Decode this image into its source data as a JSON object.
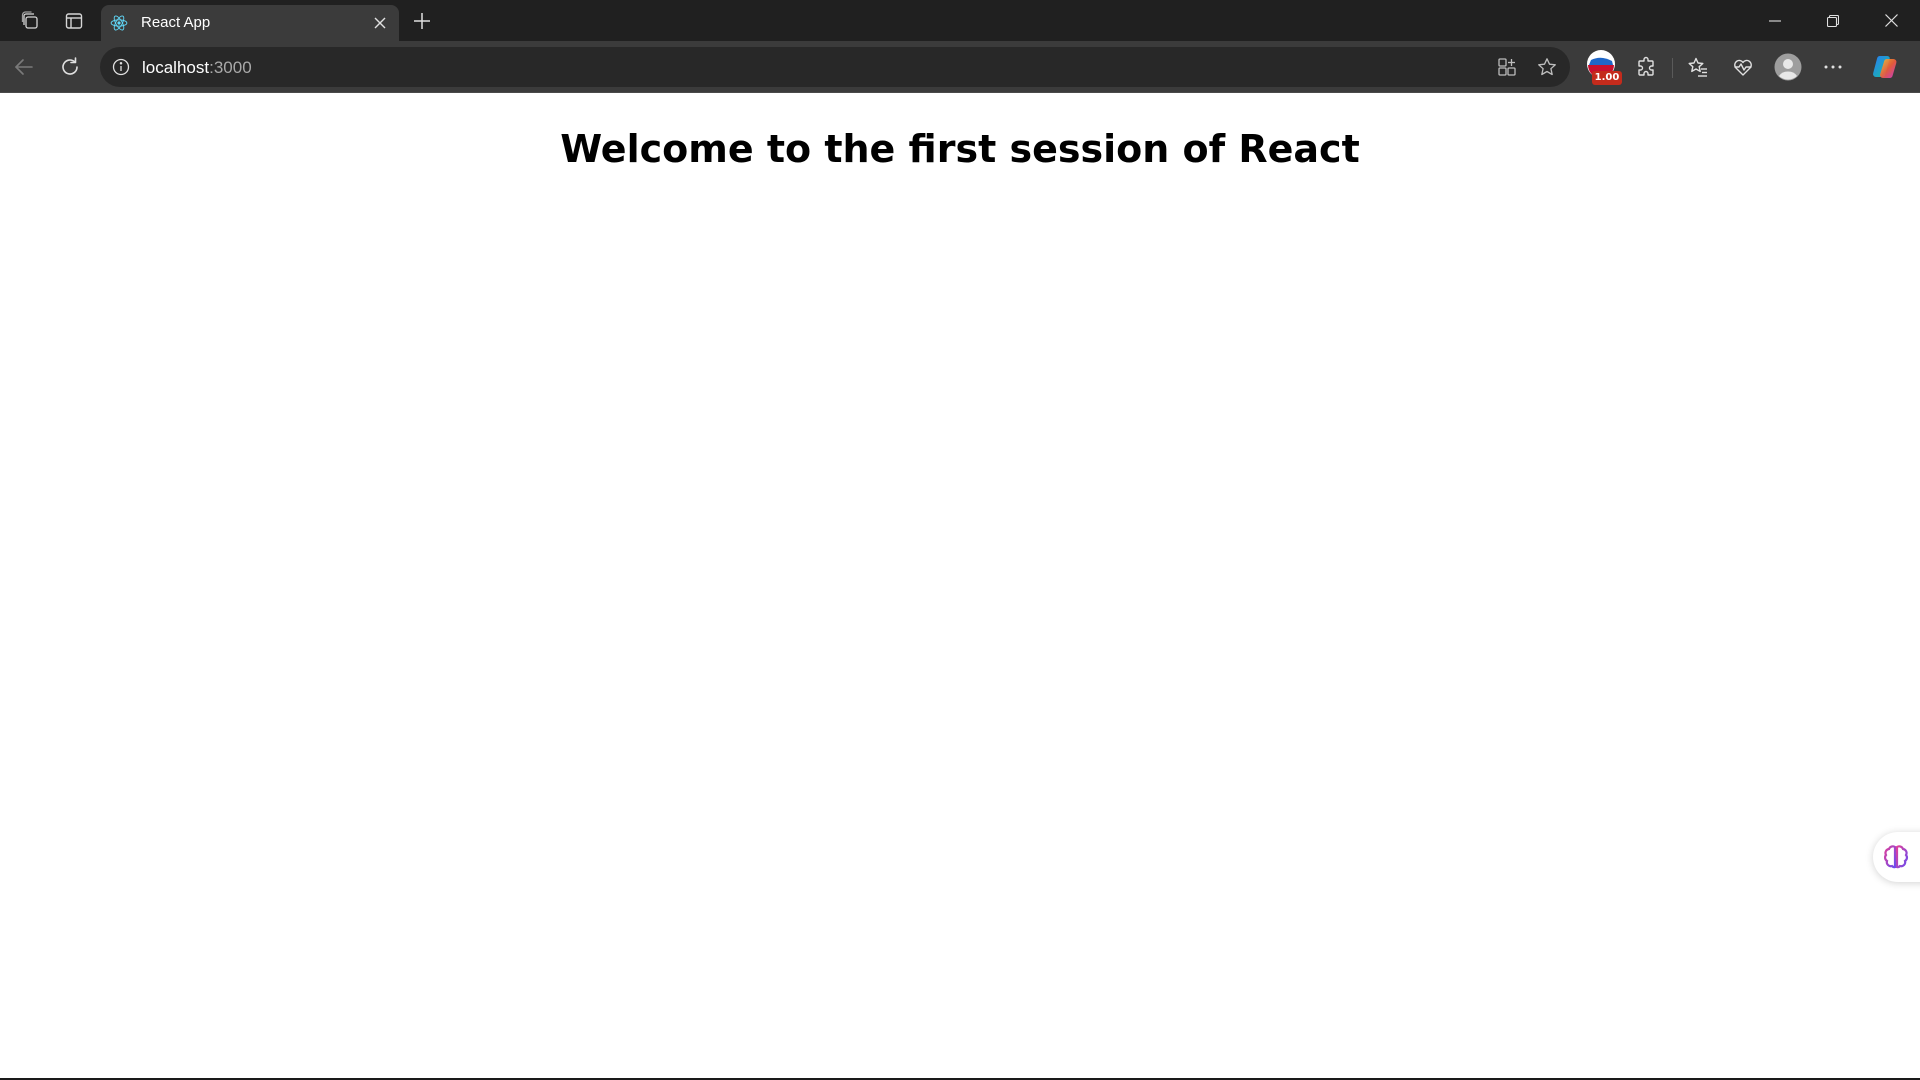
{
  "window": {
    "controls": {
      "minimize_icon": "minimize-icon",
      "restore_icon": "restore-icon",
      "close_icon": "close-icon"
    }
  },
  "tabstrip": {
    "workspaces_icon": "workspaces-icon",
    "vertical_tabs_icon": "tab-actions-icon",
    "tabs": [
      {
        "title": "React App",
        "favicon": "react-logo-icon",
        "active": true
      }
    ],
    "new_tab_icon": "plus-icon"
  },
  "toolbar": {
    "back_icon": "back-arrow-icon",
    "refresh_icon": "refresh-icon",
    "address": {
      "host": "localhost",
      "port": ":3000",
      "info_icon": "info-icon"
    },
    "address_actions": [
      "app-available-icon",
      "favorite-star-icon"
    ],
    "extension_badge": "1.00",
    "extensions_icon": "puzzle-icon",
    "favorites_icon": "favorites-list-icon",
    "browser_essentials_icon": "heart-pulse-icon",
    "profile_icon": "profile-avatar-icon",
    "more_icon": "more-dots-icon",
    "copilot_icon": "copilot-icon"
  },
  "page": {
    "heading": "Welcome to the first session of React"
  },
  "colors": {
    "tabstrip_bg": "#202020",
    "toolbar_bg": "#3b3b3b",
    "address_bg": "#282828",
    "page_bg": "#ffffff",
    "badge_red": "#c42b1c"
  }
}
